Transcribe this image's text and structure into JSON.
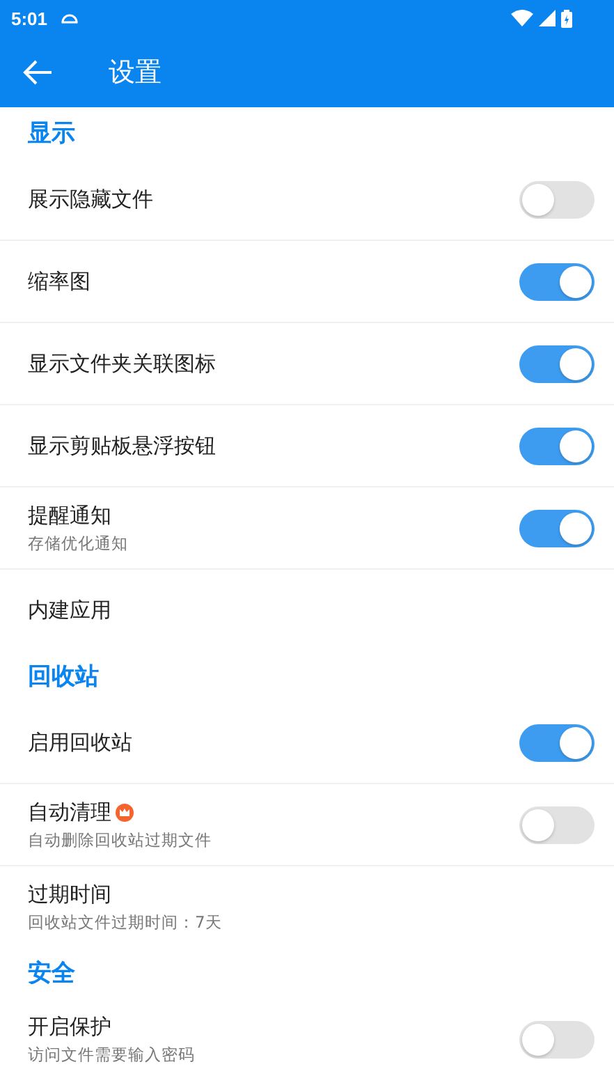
{
  "status_bar": {
    "time": "5:01"
  },
  "app_bar": {
    "title": "设置"
  },
  "sections": [
    {
      "title": "显示",
      "items": [
        {
          "kind": "toggle",
          "label": "展示隐藏文件",
          "on": false
        },
        {
          "kind": "toggle",
          "label": "缩率图",
          "on": true
        },
        {
          "kind": "toggle",
          "label": "显示文件夹关联图标",
          "on": true
        },
        {
          "kind": "toggle",
          "label": "显示剪贴板悬浮按钮",
          "on": true
        },
        {
          "kind": "toggle",
          "label": "提醒通知",
          "subtitle": "存储优化通知",
          "on": true
        },
        {
          "kind": "plain",
          "label": "内建应用"
        }
      ]
    },
    {
      "title": "回收站",
      "items": [
        {
          "kind": "toggle",
          "label": "启用回收站",
          "on": true
        },
        {
          "kind": "toggle",
          "label": "自动清理",
          "subtitle": "自动删除回收站过期文件",
          "on": false,
          "badge": true
        },
        {
          "kind": "plain",
          "label": "过期时间",
          "subtitle": "回收站文件过期时间：7天"
        }
      ]
    },
    {
      "title": "安全",
      "items": [
        {
          "kind": "toggle",
          "label": "开启保护",
          "subtitle": "访问文件需要输入密码",
          "on": false
        }
      ]
    }
  ]
}
